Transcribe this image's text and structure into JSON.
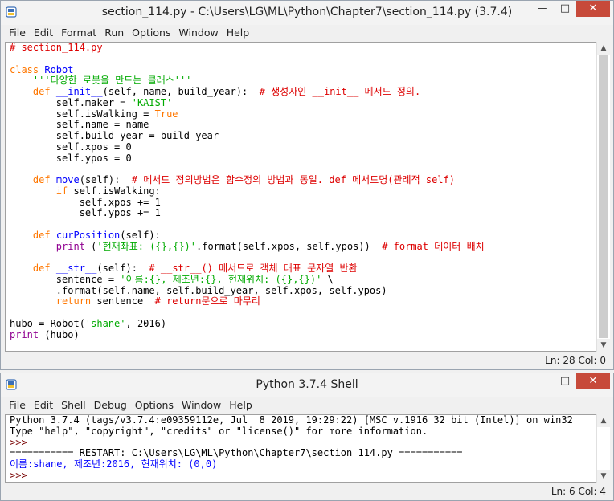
{
  "editor_window": {
    "title": "section_114.py - C:\\Users\\LG\\ML\\Python\\Chapter7\\section_114.py (3.7.4)",
    "menu": [
      "File",
      "Edit",
      "Format",
      "Run",
      "Options",
      "Window",
      "Help"
    ],
    "status": "Ln: 28  Col: 0",
    "lines": {
      "l1": "# section_114.py",
      "l3a": "class ",
      "l3b": "Robot",
      "l4": "'''다양한 로봇을 만드는 클래스'''",
      "l5a": "def ",
      "l5b": "__init__",
      "l5c": "(self, name, build_year):  ",
      "l5d": "# 생성자인 __init__ 메서드 정의.",
      "l6a": "self.maker = ",
      "l6b": "'KAIST'",
      "l7a": "self.isWalking = ",
      "l7b": "True",
      "l8": "self.name = name",
      "l9": "self.build_year = build_year",
      "l10": "self.xpos = 0",
      "l11": "self.ypos = 0",
      "l13a": "def ",
      "l13b": "move",
      "l13c": "(self):  ",
      "l13d": "# 메서드 정의방법은 함수정의 방법과 동일. def 메서드명(관례적 self)",
      "l14a": "if ",
      "l14b": "self.isWalking:",
      "l15": "self.xpos += 1",
      "l16": "self.ypos += 1",
      "l18a": "def ",
      "l18b": "curPosition",
      "l18c": "(self):",
      "l19a": "print",
      "l19b": " (",
      "l19c": "'현재좌표: ({},{})'",
      "l19d": ".format(self.xpos, self.ypos))  ",
      "l19e": "# format 데이터 배치",
      "l21a": "def ",
      "l21b": "__str__",
      "l21c": "(self):  ",
      "l21d": "# __str__() 메서드로 객체 대표 문자열 반환",
      "l22a": "sentence = ",
      "l22b": "'이름:{}, 제조년:{}, 현재위치: ({},{})'",
      "l22c": " \\",
      "l23": ".format(self.name, self.build_year, self.xpos, self.ypos)",
      "l24a": "return ",
      "l24b": "sentence  ",
      "l24c": "# return문으로 마무리",
      "l26a": "hubo = Robot(",
      "l26b": "'shane'",
      "l26c": ", 2016)",
      "l27a": "print",
      "l27b": " (hubo)"
    }
  },
  "shell_window": {
    "title": "Python 3.7.4 Shell",
    "menu": [
      "File",
      "Edit",
      "Shell",
      "Debug",
      "Options",
      "Window",
      "Help"
    ],
    "status": "Ln: 6  Col: 4",
    "lines": {
      "s1": "Python 3.7.4 (tags/v3.7.4:e09359112e, Jul  8 2019, 19:29:22) [MSC v.1916 32 bit (Intel)] on win32",
      "s2": "Type \"help\", \"copyright\", \"credits\" or \"license()\" for more information.",
      "s3": ">>> ",
      "s4": "=========== RESTART: C:\\Users\\LG\\ML\\Python\\Chapter7\\section_114.py ===========",
      "s5": "이름:shane, 제조년:2016, 현재위치: (0,0)",
      "s6": ">>> "
    }
  },
  "colors": {
    "comment": "#dd0000",
    "keyword": "#ff7700",
    "string": "#00aa00",
    "definition": "#0000ff",
    "builtin": "#900090",
    "close": "#c74a3a"
  },
  "icons": {
    "window_minimize": "minimize-icon",
    "window_maximize": "maximize-icon",
    "window_close": "close-icon",
    "app": "python-idle-icon"
  }
}
